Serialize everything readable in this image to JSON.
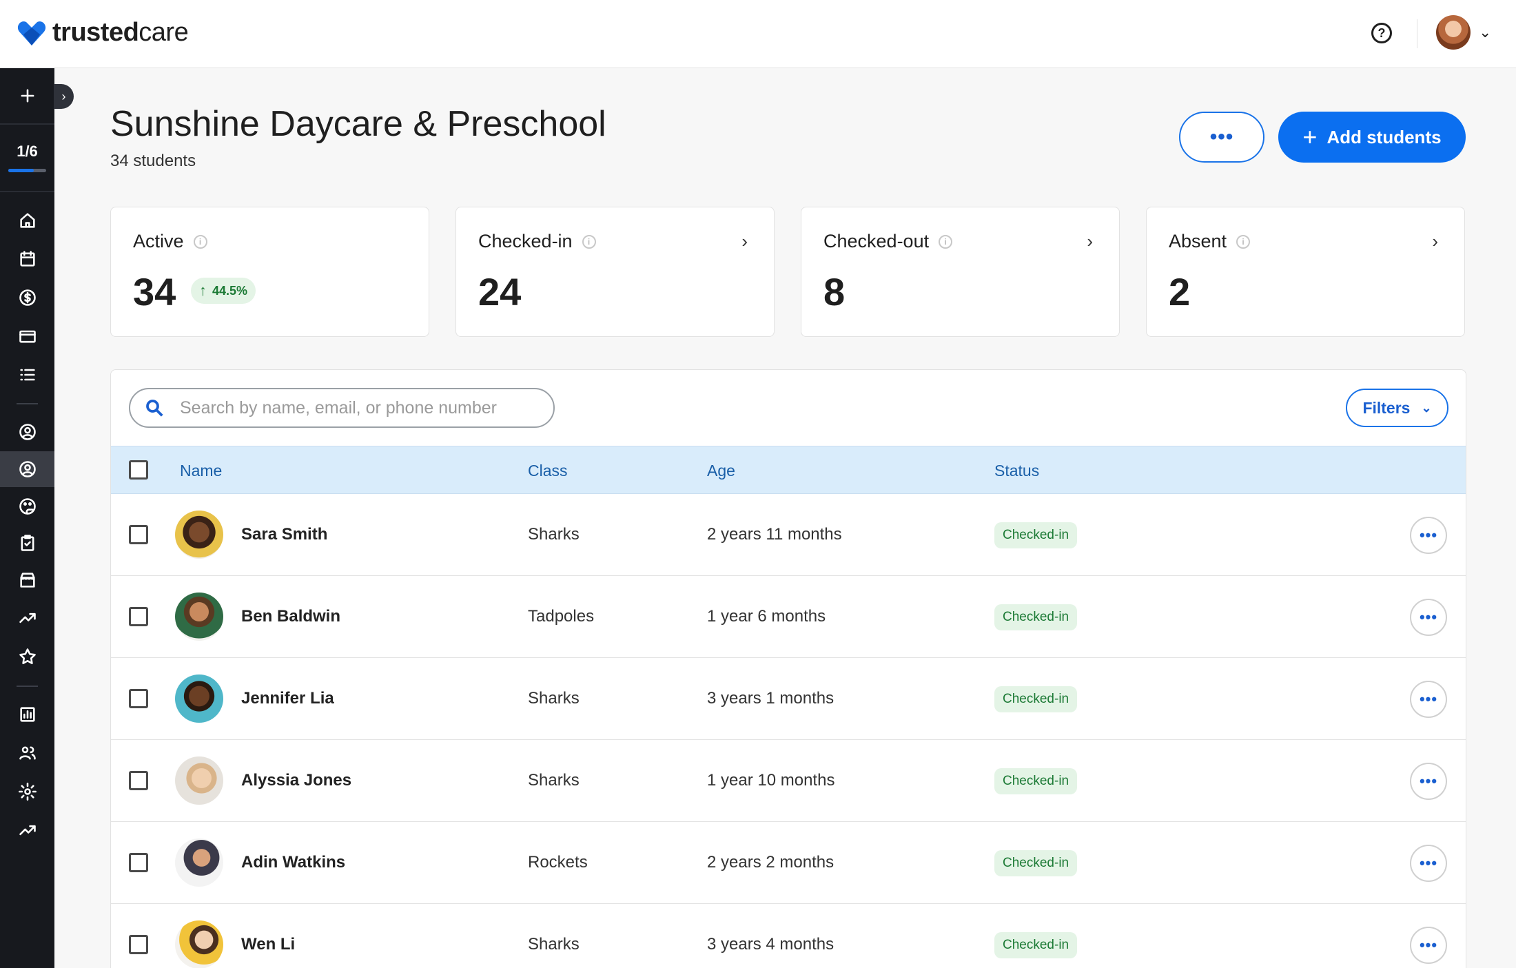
{
  "app": {
    "brand_bold": "trusted",
    "brand_light": "care"
  },
  "sidebar": {
    "progress_label": "1/6",
    "progress_fraction": 0.67,
    "items": [
      {
        "icon": "plus-icon"
      },
      {
        "icon": "home-icon"
      },
      {
        "icon": "calendar-icon"
      },
      {
        "icon": "dollar-icon"
      },
      {
        "icon": "credit-card-icon"
      },
      {
        "icon": "list-icon"
      },
      {
        "icon": "user-circle-icon"
      },
      {
        "icon": "student-icon"
      },
      {
        "icon": "palette-icon"
      },
      {
        "icon": "clipboard-check-icon"
      },
      {
        "icon": "store-icon"
      },
      {
        "icon": "trending-up-icon"
      },
      {
        "icon": "star-icon"
      },
      {
        "icon": "bar-chart-icon"
      },
      {
        "icon": "people-icon"
      },
      {
        "icon": "gear-icon"
      },
      {
        "icon": "trending-up-icon"
      }
    ]
  },
  "header": {
    "title": "Sunshine Daycare & Preschool",
    "subtitle": "34 students",
    "add_label": "Add students"
  },
  "stats": [
    {
      "label": "Active",
      "value": "34",
      "trend": "44.5%",
      "has_chevron": false
    },
    {
      "label": "Checked-in",
      "value": "24",
      "has_chevron": true
    },
    {
      "label": "Checked-out",
      "value": "8",
      "has_chevron": true
    },
    {
      "label": "Absent",
      "value": "2",
      "has_chevron": true
    }
  ],
  "search": {
    "placeholder": "Search by name, email, or phone number"
  },
  "filters_label": "Filters",
  "table": {
    "columns": [
      "Name",
      "Class",
      "Age",
      "Status"
    ],
    "rows": [
      {
        "name": "Sara Smith",
        "class": "Sharks",
        "age": "2 years 11 months",
        "status": "Checked-in"
      },
      {
        "name": "Ben Baldwin",
        "class": "Tadpoles",
        "age": "1 year 6 months",
        "status": "Checked-in"
      },
      {
        "name": "Jennifer Lia",
        "class": "Sharks",
        "age": "3 years 1 months",
        "status": "Checked-in"
      },
      {
        "name": "Alyssia Jones",
        "class": "Sharks",
        "age": "1 year 10 months",
        "status": "Checked-in"
      },
      {
        "name": "Adin Watkins",
        "class": "Rockets",
        "age": "2 years 2 months",
        "status": "Checked-in"
      },
      {
        "name": "Wen Li",
        "class": "Sharks",
        "age": "3 years 4 months",
        "status": "Checked-in"
      }
    ]
  },
  "colors": {
    "accent": "#0b6ff0",
    "status_green": "#1c7a35",
    "sidebar_bg": "#17191e"
  }
}
